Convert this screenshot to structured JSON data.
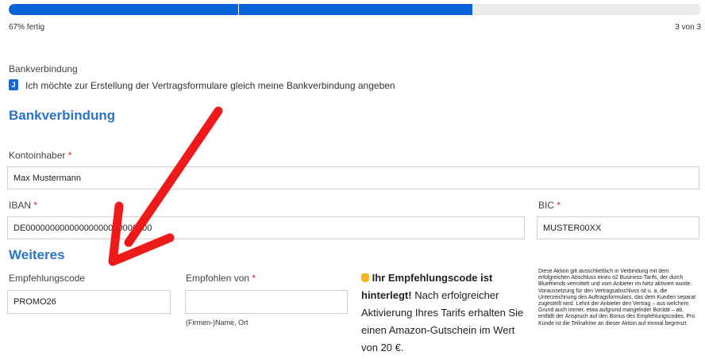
{
  "progress": {
    "fraction": 0.67,
    "label": "67% fertig",
    "step": "3 von 3",
    "fill_color": "#0a63d6",
    "track_color": "#ebebeb"
  },
  "bank_toggle": {
    "heading": "Bankverbindung",
    "checkbox_glyph": "J",
    "checkbox_label": "Ich möchte zur Erstellung der Vertragsformulare gleich meine Bankverbindung angeben",
    "checked": true
  },
  "bank_section": {
    "title": "Bankverbindung",
    "account_holder": {
      "label": "Kontoinhaber",
      "required": "*",
      "value": "Max Mustermann"
    },
    "iban": {
      "label": "IBAN",
      "required": "*",
      "value": "DE00000000000000000000000000"
    },
    "bic": {
      "label": "BIC",
      "required": "*",
      "value": "MUSTER00XX"
    }
  },
  "more_section": {
    "title": "Weiteres",
    "referral_code": {
      "label": "Empfehlungscode",
      "value": "PROMO26"
    },
    "referred_by": {
      "label": "Empfohlen von",
      "required": "*",
      "value": "",
      "hint": "(Firmen-)Name, Ort"
    }
  },
  "promo": {
    "icon": "thumbs-up-icon",
    "bold_text": "Ihr Empfehlungscode ist hinterlegt!",
    "text": "Nach erfolgreicher Aktivierung Ihres Tarifs erhalten Sie einen Amazon-Gutschein im Wert von 20 €."
  },
  "fine_print": "Diese Aktion gilt ausschließlich in Verbindung mit dem erfolgreichen Abschluss eines o2 Business-Tarifs, der durch Bluefriends vermittelt und vom Anbieter im Netz aktiviert wurde. Voraussetzung für den Vertragsabschluss ist u. a. die Unterzeichnung des Auftragsformulars, das dem Kunden separat zugestellt wird. Lehnt der Anbieter den Vertrag – aus welchem Grund auch immer, etwa aufgrund mangelnder Bonität – ab, entfällt der Anspruch auf den Bonus des Empfehlungscodes. Pro Kunde ist die Teilnahme an dieser Aktion auf einmal begrenzt.",
  "annotation": {
    "arrow_color": "#ee1a1a"
  }
}
